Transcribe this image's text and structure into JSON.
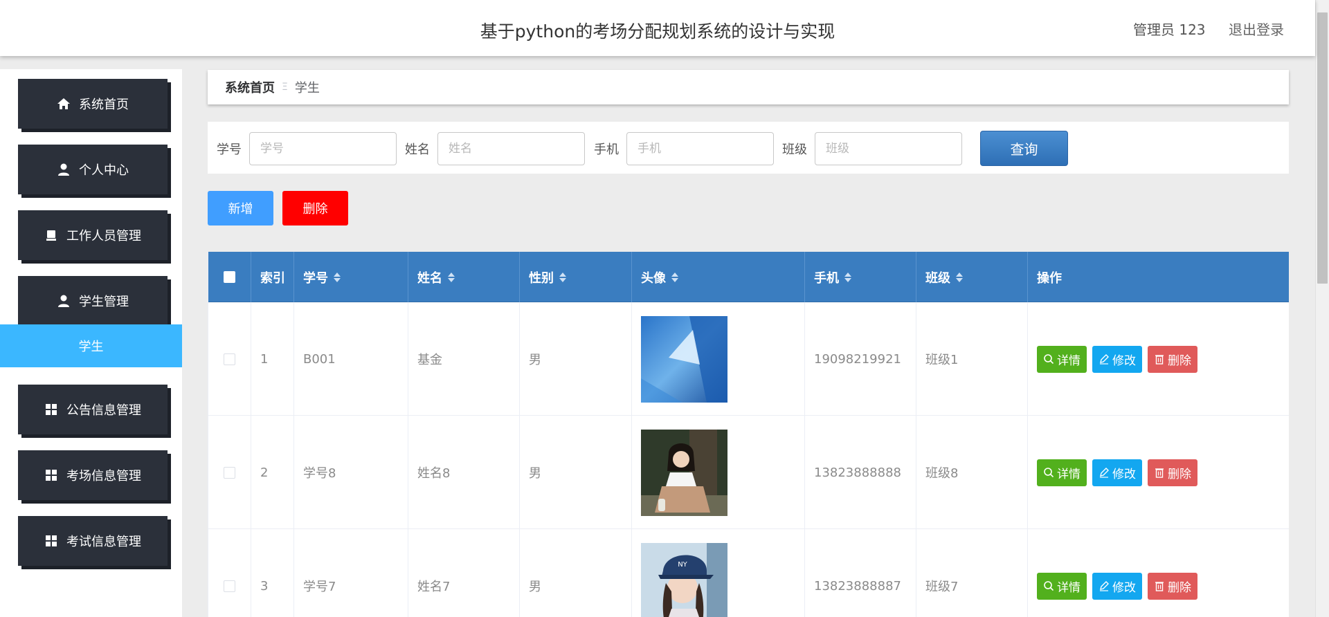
{
  "header": {
    "title": "基于python的考场分配规划系统的设计与实现",
    "user_label": "管理员 123",
    "logout_label": "退出登录"
  },
  "sidebar": {
    "items": [
      {
        "label": "系统首页",
        "icon": "home-icon"
      },
      {
        "label": "个人中心",
        "icon": "user-icon"
      },
      {
        "label": "工作人员管理",
        "icon": "clipboard-icon"
      },
      {
        "label": "学生管理",
        "icon": "user-icon"
      },
      {
        "label": "公告信息管理",
        "icon": "grid-icon"
      },
      {
        "label": "考场信息管理",
        "icon": "grid-icon"
      },
      {
        "label": "考试信息管理",
        "icon": "grid-icon"
      }
    ],
    "active_sub": "学生"
  },
  "breadcrumb": {
    "home": "系统首页",
    "separator": "Ξ",
    "current": "学生"
  },
  "search": {
    "fields": [
      {
        "label": "学号",
        "placeholder": "学号"
      },
      {
        "label": "姓名",
        "placeholder": "姓名"
      },
      {
        "label": "手机",
        "placeholder": "手机"
      },
      {
        "label": "班级",
        "placeholder": "班级"
      }
    ],
    "query_label": "查询"
  },
  "actions": {
    "add_label": "新增",
    "delete_label": "删除"
  },
  "table": {
    "header_color": "#3a7dc0",
    "columns": [
      "索引",
      "学号",
      "姓名",
      "性别",
      "头像",
      "手机",
      "班级",
      "操作"
    ],
    "rows": [
      {
        "index": "1",
        "id": "B001",
        "name": "基金",
        "gender": "男",
        "phone": "19098219921",
        "class": "班级1",
        "avatar": "blue abstract"
      },
      {
        "index": "2",
        "id": "学号8",
        "name": "姓名8",
        "gender": "男",
        "phone": "13823888888",
        "class": "班级8",
        "avatar": "woman sitting"
      },
      {
        "index": "3",
        "id": "学号7",
        "name": "姓名7",
        "gender": "男",
        "phone": "13823888887",
        "class": "班级7",
        "avatar": "woman in cap"
      }
    ],
    "ops": {
      "detail": "详情",
      "edit": "修改",
      "delete": "删除"
    }
  },
  "colors": {
    "sidebar_btn": "#2b303a",
    "active_sub": "#3bb7ff",
    "add_btn": "#409eff",
    "delete_btn": "#ff0000",
    "detail_btn": "#52b01d",
    "edit_btn": "#13a7f0",
    "row_delete_btn": "#e05a5a"
  }
}
